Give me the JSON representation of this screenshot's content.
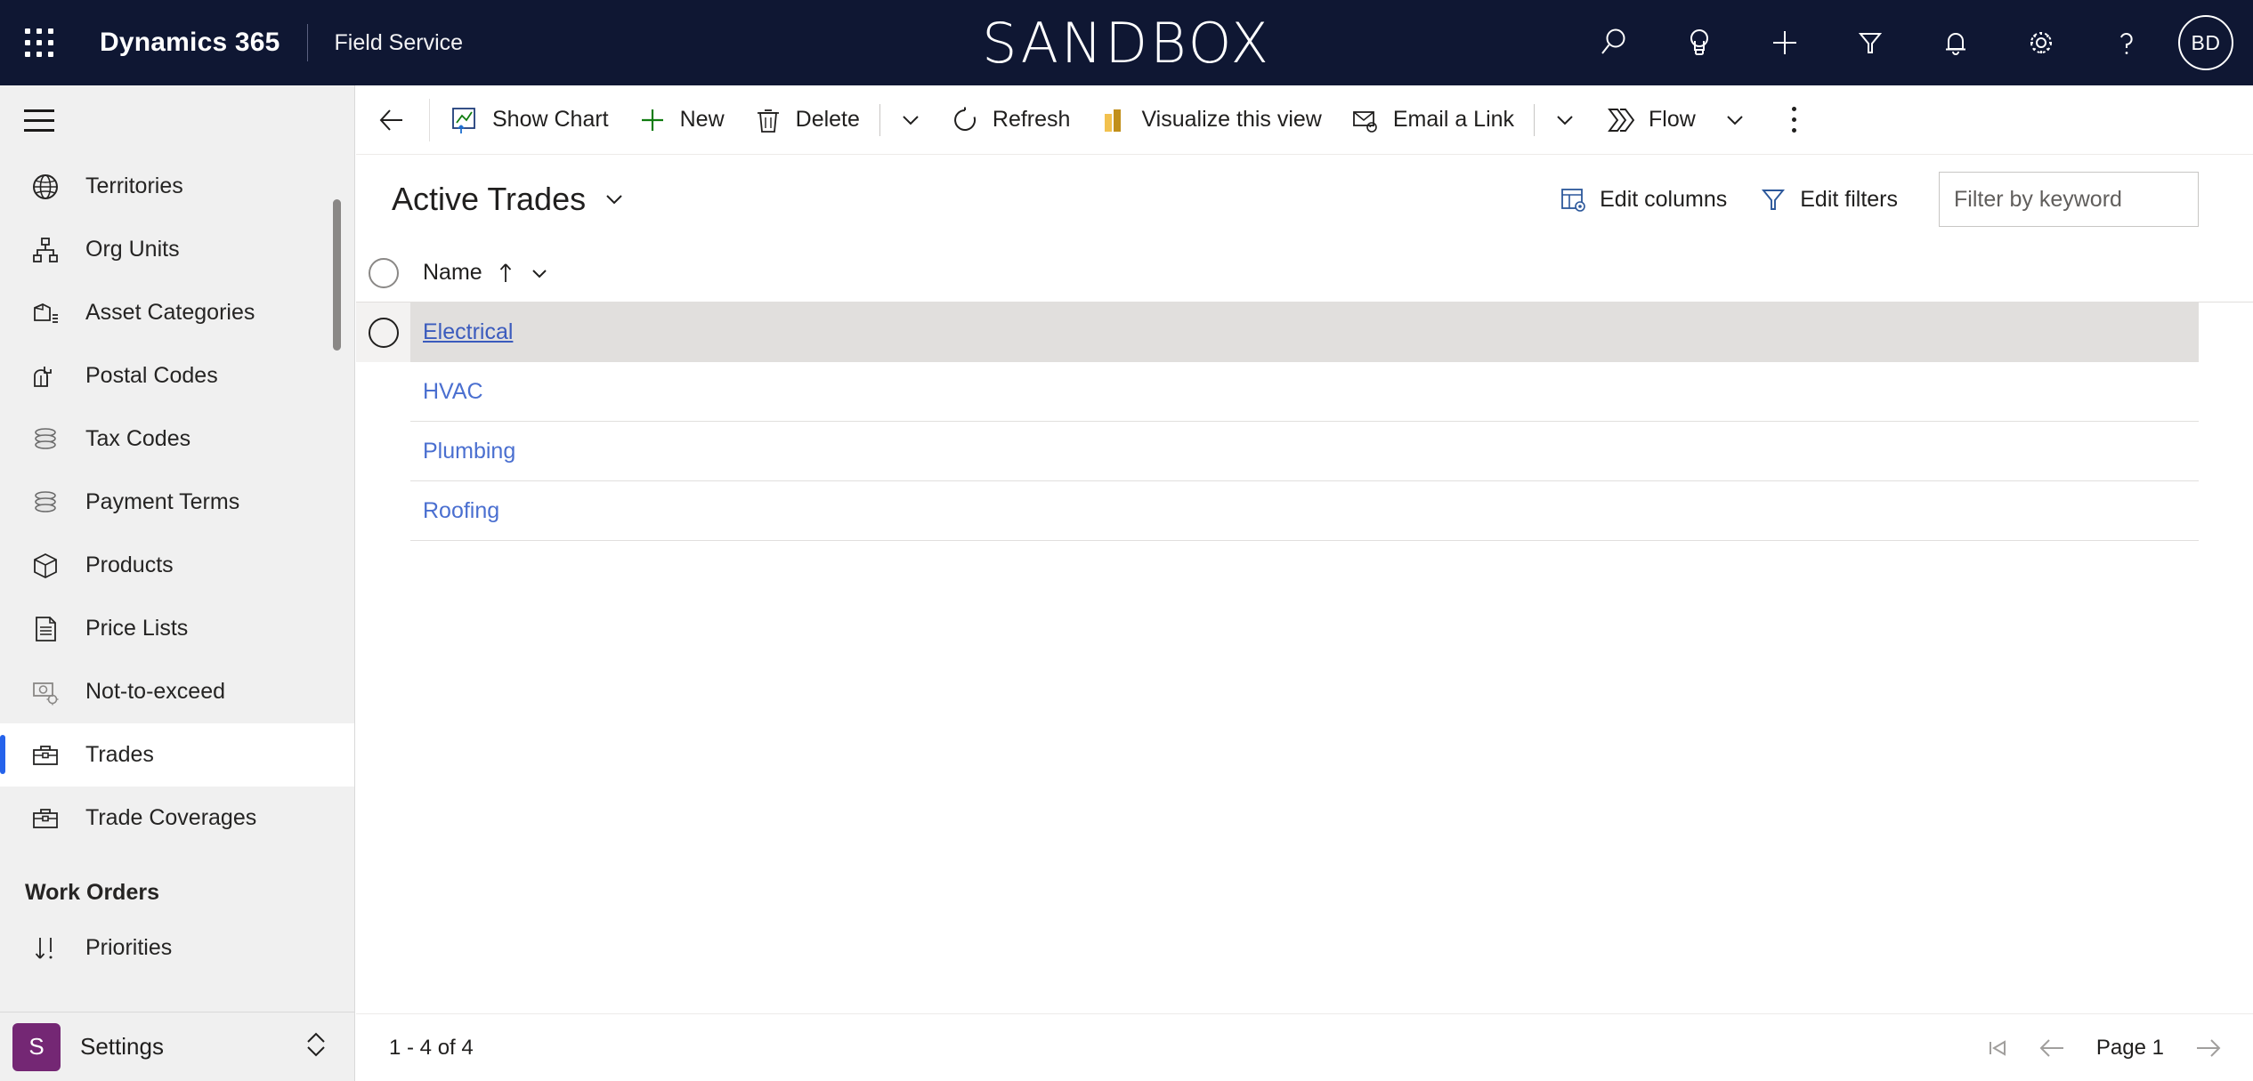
{
  "header": {
    "waffle_icon": "app-launcher-icon",
    "brand": "Dynamics 365",
    "app_name": "Field Service",
    "environment_banner": "SANDBOX",
    "actions": [
      {
        "name": "search-icon",
        "label": "Search"
      },
      {
        "name": "lightbulb-icon",
        "label": "Assistant"
      },
      {
        "name": "plus-icon",
        "label": "Quick create"
      },
      {
        "name": "filter-funnel-icon",
        "label": "Filters"
      },
      {
        "name": "bell-icon",
        "label": "Notifications"
      },
      {
        "name": "gear-icon",
        "label": "Settings"
      },
      {
        "name": "question-mark-icon",
        "label": "Help"
      }
    ],
    "avatar_initials": "BD"
  },
  "sidebar": {
    "hamburger_icon": "hamburger-menu-icon",
    "items": [
      {
        "label": "Territories",
        "icon": "globe-icon",
        "selected": false
      },
      {
        "label": "Org Units",
        "icon": "org-chart-icon",
        "selected": false
      },
      {
        "label": "Asset Categories",
        "icon": "asset-box-list-icon",
        "selected": false
      },
      {
        "label": "Postal Codes",
        "icon": "mailbox-icon",
        "selected": false
      },
      {
        "label": "Tax Codes",
        "icon": "database-stack-icon",
        "selected": false
      },
      {
        "label": "Payment Terms",
        "icon": "database-stack-icon",
        "selected": false
      },
      {
        "label": "Products",
        "icon": "package-box-icon",
        "selected": false
      },
      {
        "label": "Price Lists",
        "icon": "document-list-icon",
        "selected": false
      },
      {
        "label": "Not-to-exceed",
        "icon": "money-gear-icon",
        "selected": false
      },
      {
        "label": "Trades",
        "icon": "toolbox-icon",
        "selected": true
      },
      {
        "label": "Trade Coverages",
        "icon": "toolbox-icon",
        "selected": false
      }
    ],
    "group_header": "Work Orders",
    "group_items": [
      {
        "label": "Priorities",
        "icon": "sort-priority-icon",
        "selected": false
      }
    ],
    "area_switcher": {
      "badge": "S",
      "label": "Settings",
      "chevron_icon": "chevron-up-down-icon"
    }
  },
  "commandbar": {
    "back_icon": "arrow-left-icon",
    "show_chart": "Show Chart",
    "new": "New",
    "delete": "Delete",
    "refresh": "Refresh",
    "visualize": "Visualize this view",
    "email_link": "Email a Link",
    "flow": "Flow",
    "overflow_icon": "more-vertical-icon"
  },
  "view": {
    "title": "Active Trades",
    "title_chevron_icon": "chevron-down-icon",
    "edit_columns": "Edit columns",
    "edit_filters": "Edit filters",
    "search_placeholder": "Filter by keyword",
    "search_value": ""
  },
  "grid": {
    "columns": [
      {
        "label": "Name",
        "sort": "ascending",
        "sort_icon": "arrow-up-icon",
        "menu_icon": "chevron-down-icon"
      }
    ],
    "rows": [
      {
        "name": "Electrical",
        "hovered": true
      },
      {
        "name": "HVAC",
        "hovered": false
      },
      {
        "name": "Plumbing",
        "hovered": false
      },
      {
        "name": "Roofing",
        "hovered": false
      }
    ]
  },
  "footer": {
    "record_count": "1 - 4 of 4",
    "page_label": "Page 1",
    "first_page_icon": "page-first-icon",
    "prev_page_icon": "arrow-left-icon",
    "next_page_icon": "arrow-right-icon"
  },
  "colors": {
    "header_bg": "#0f1733",
    "accent_blue": "#2563eb",
    "link_blue": "#4a6fd0",
    "sidebar_bg": "#f0f0f0",
    "row_hover": "#e1dfdd",
    "area_badge": "#742774",
    "new_green": "#107c10",
    "visualize_gold": "#d9a12a"
  }
}
